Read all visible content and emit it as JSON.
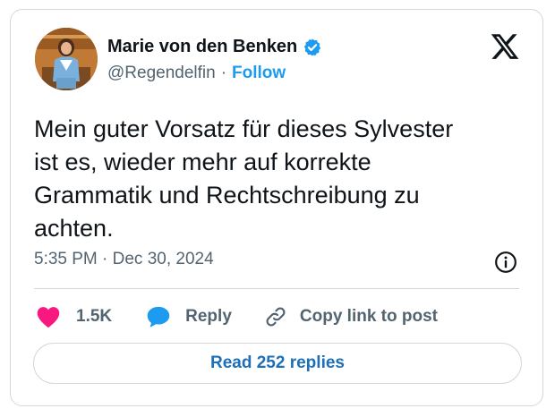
{
  "author": {
    "name": "Marie von den Benken",
    "handle": "@Regendelfin",
    "separator": "·",
    "follow_label": "Follow",
    "verified": true
  },
  "tweet": {
    "text": "Mein guter Vorsatz für dieses Sylvester\nist es, wieder mehr auf korrekte\nGrammatik und Rechtschreibung zu\nachten.",
    "timestamp": "5:35 PM · Dec 30, 2024"
  },
  "actions": {
    "like_count": "1.5K",
    "reply_label": "Reply",
    "copy_link_label": "Copy link to post"
  },
  "footer": {
    "read_replies_label": "Read 252 replies"
  },
  "icons": {
    "brand": "x-logo-icon",
    "verified": "verified-badge-icon",
    "info": "info-icon",
    "like": "heart-icon",
    "reply": "chat-bubble-icon",
    "copy": "link-icon"
  },
  "colors": {
    "accent": "#1d9bf0",
    "like": "#f91880",
    "text": "#0f1419",
    "muted": "#536471",
    "border": "#cfd9de"
  }
}
